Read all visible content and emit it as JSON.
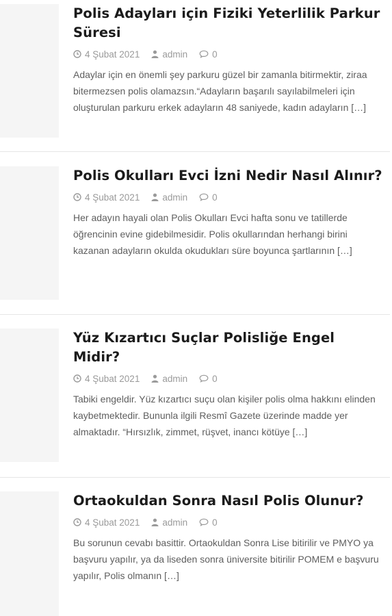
{
  "posts": [
    {
      "title": "Polis Adayları için Fiziki Yeterlilik Parkur Süresi",
      "date": "4 Şubat 2021",
      "author": "admin",
      "comments": "0",
      "excerpt": "Adaylar için en önemli şey parkuru güzel bir zamanla bitirmektir, ziraa bitermezsen polis olamazsın.“Adayların başarılı sayılabilmeleri için oluşturulan parkuru erkek adayların 48 saniyede, kadın adayların […]"
    },
    {
      "title": "Polis Okulları Evci İzni Nedir Nasıl Alınır?",
      "date": "4 Şubat 2021",
      "author": "admin",
      "comments": "0",
      "excerpt": "Her adayın hayali olan Polis Okulları Evci hafta sonu ve tatillerde öğrencinin evine gidebilmesidir. Polis okullarından herhangi birini kazanan adayların okulda okudukları süre boyunca şartlarının […]"
    },
    {
      "title": "Yüz Kızartıcı Suçlar Polisliğe Engel Midir?",
      "date": "4 Şubat 2021",
      "author": "admin",
      "comments": "0",
      "excerpt": "Tabiki engeldir. Yüz kızartıcı suçu olan kişiler polis olma hakkını elinden kaybetmektedir. Bununla ilgili Resmî Gazete üzerinde madde yer almaktadır. “Hırsızlık, zimmet, rüşvet, inancı kötüye […]"
    },
    {
      "title": "Ortaokuldan Sonra Nasıl Polis Olunur?",
      "date": "4 Şubat 2021",
      "author": "admin",
      "comments": "0",
      "excerpt": "Bu sorunun cevabı basittir. Ortaokuldan Sonra Lise bitirilir ve PMYO ya başvuru yapılır, ya da liseden sonra üniversite bitirilir POMEM e başvuru yapılır, Polis olmanın […]"
    }
  ],
  "icons": {
    "date": "clock-icon",
    "author": "user-icon",
    "comments": "comment-icon"
  },
  "colors": {
    "title": "#1b1b1b",
    "meta": "#9a9a9a",
    "excerpt": "#5e5e5e",
    "thumbnail_placeholder": "#f5f5f5",
    "divider": "#e6e6e6"
  }
}
